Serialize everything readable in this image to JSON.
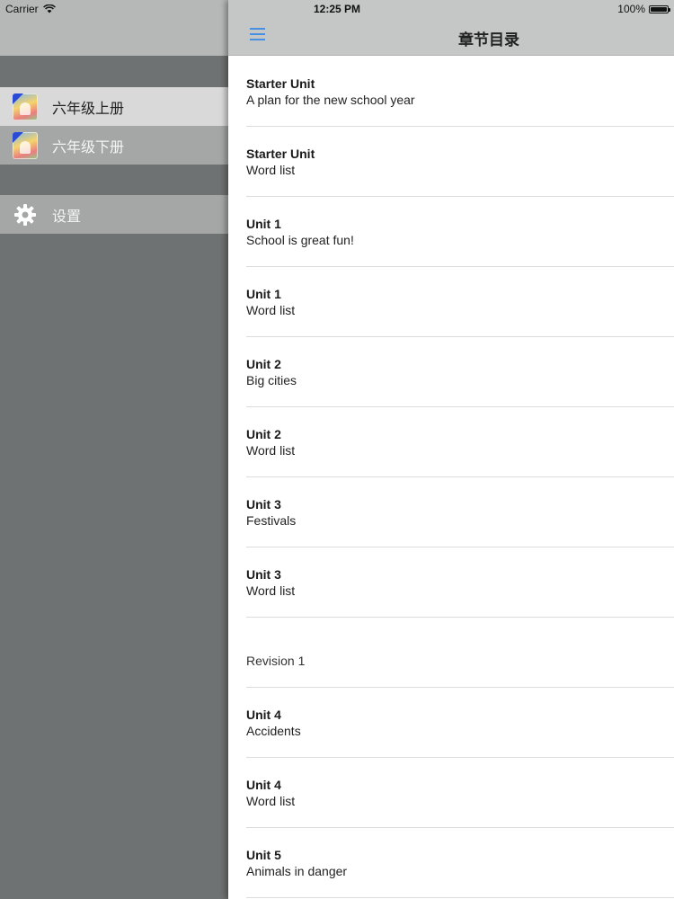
{
  "status_bar": {
    "carrier": "Carrier",
    "time": "12:25 PM",
    "battery": "100%",
    "battery_level": 1.0
  },
  "sidebar": {
    "items": [
      {
        "label": "六年级上册",
        "icon": "book-cover-icon",
        "state": "active"
      },
      {
        "label": "六年级下册",
        "icon": "book-cover-icon",
        "state": "normal"
      },
      {
        "label": "设置",
        "icon": "gear-icon",
        "state": "normal"
      }
    ]
  },
  "nav_bar": {
    "title": "章节目录",
    "menu_icon": "hamburger-icon",
    "accent_color": "#4a90e2"
  },
  "chapters": [
    {
      "title": "Starter Unit",
      "subtitle": "A plan for the new school year"
    },
    {
      "title": "Starter Unit",
      "subtitle": "Word list"
    },
    {
      "title": "Unit 1",
      "subtitle": "School is great fun!"
    },
    {
      "title": "Unit 1",
      "subtitle": "Word list"
    },
    {
      "title": "Unit 2",
      "subtitle": "Big cities"
    },
    {
      "title": "Unit 2",
      "subtitle": "Word list"
    },
    {
      "title": "Unit 3",
      "subtitle": "Festivals"
    },
    {
      "title": "Unit 3",
      "subtitle": "Word list"
    },
    {
      "title": "",
      "subtitle": "Revision 1"
    },
    {
      "title": "Unit 4",
      "subtitle": "Accidents"
    },
    {
      "title": "Unit 4",
      "subtitle": "Word list"
    },
    {
      "title": "Unit 5",
      "subtitle": "Animals in danger"
    }
  ]
}
